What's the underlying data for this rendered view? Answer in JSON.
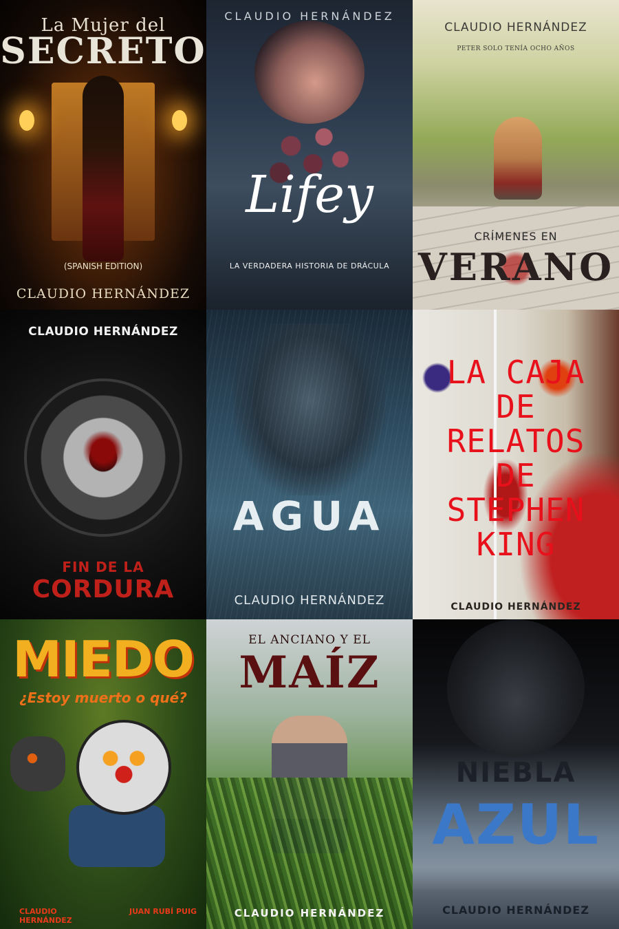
{
  "covers": [
    {
      "author": "CLAUDIO HERNÁNDEZ",
      "title_line1": "La Mujer del",
      "title_line2": "SECRETO",
      "edition": "(SPANISH EDITION)"
    },
    {
      "author": "CLAUDIO HERNÁNDEZ",
      "title": "Lifey",
      "subtitle": "LA VERDADERA HISTORIA DE DRÁCULA"
    },
    {
      "author": "CLAUDIO HERNÁNDEZ",
      "tagline": "PETER SOLO TENÍA OCHO AÑOS",
      "title_line1": "CRÍMENES EN",
      "title_line2": "VERANO"
    },
    {
      "author": "CLAUDIO HERNÁNDEZ",
      "title_line1": "FIN DE LA",
      "title_line2": "CORDURA"
    },
    {
      "author": "CLAUDIO HERNÁNDEZ",
      "title": "AGUA"
    },
    {
      "author": "CLAUDIO HERNÁNDEZ",
      "title": "LA CAJA DE RELATOS DE STEPHEN KING"
    },
    {
      "title": "MIEDO",
      "subtitle": "¿Estoy muerto o qué?",
      "author": "CLAUDIO HERNÁNDEZ",
      "coauthor": "JUAN RUBÍ PUIG"
    },
    {
      "title_line1": "EL ANCIANO Y EL",
      "title_line2": "MAÍZ",
      "author": "CLAUDIO HERNÁNDEZ"
    },
    {
      "title_line1": "NIEBLA",
      "title_line2": "AZUL",
      "author": "CLAUDIO HERNÁNDEZ"
    }
  ]
}
